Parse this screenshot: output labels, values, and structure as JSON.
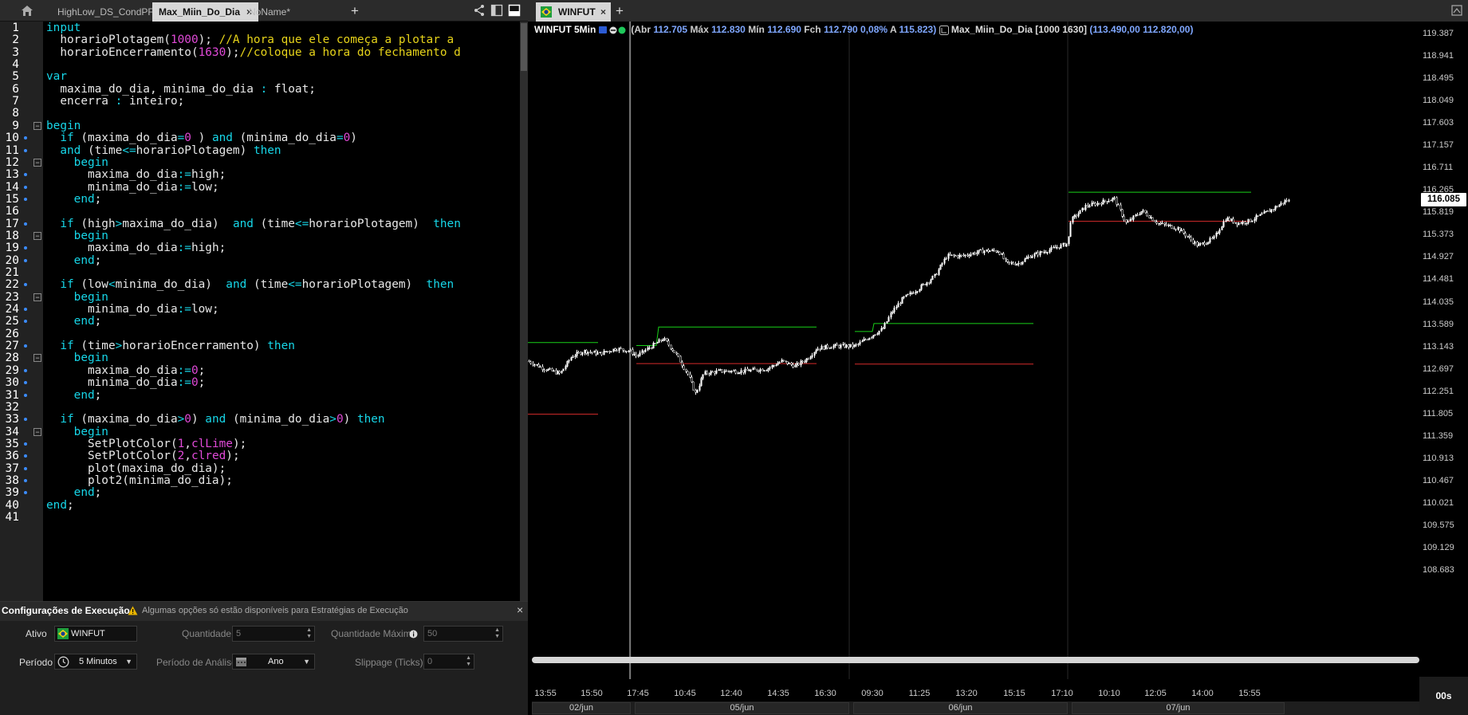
{
  "editor": {
    "tabs": [
      {
        "label": "HighLow_DS_CondPF_Agr",
        "active": false
      },
      {
        "label": "Max_Miin_Do_Dia",
        "active": true,
        "close": "×"
      },
      {
        "label": "NoName*",
        "active": false
      }
    ],
    "add_tab": "+",
    "lines": [
      {
        "n": "1",
        "segs": [
          [
            "kw",
            "input"
          ]
        ]
      },
      {
        "n": "2",
        "segs": [
          [
            "",
            "  horarioPlotagem("
          ],
          [
            "num",
            "1000"
          ],
          [
            "",
            "); "
          ],
          [
            "cm",
            "//A hora que ele começa a plotar a"
          ]
        ]
      },
      {
        "n": "3",
        "segs": [
          [
            "",
            "  horarioEncerramento("
          ],
          [
            "num",
            "1630"
          ],
          [
            "",
            ");"
          ],
          [
            "cm",
            "//coloque a hora do fechamento d"
          ]
        ]
      },
      {
        "n": "4",
        "segs": []
      },
      {
        "n": "5",
        "segs": [
          [
            "kw",
            "var"
          ]
        ]
      },
      {
        "n": "6",
        "segs": [
          [
            "",
            "  maxima_do_dia, minima_do_dia "
          ],
          [
            "op",
            ":"
          ],
          [
            "",
            " float;"
          ]
        ]
      },
      {
        "n": "7",
        "segs": [
          [
            "",
            "  encerra "
          ],
          [
            "op",
            ":"
          ],
          [
            "",
            " inteiro;"
          ]
        ]
      },
      {
        "n": "8",
        "segs": []
      },
      {
        "n": "9",
        "segs": [
          [
            "kw",
            "begin"
          ]
        ]
      },
      {
        "n": "10",
        "segs": [
          [
            "",
            "  "
          ],
          [
            "kw",
            "if"
          ],
          [
            "",
            " (maxima_do_dia"
          ],
          [
            "op",
            "="
          ],
          [
            "num",
            "0"
          ],
          [
            "",
            " ) "
          ],
          [
            "kw",
            "and"
          ],
          [
            "",
            " (minima_do_dia"
          ],
          [
            "op",
            "="
          ],
          [
            "num",
            "0"
          ],
          [
            "",
            ")"
          ]
        ]
      },
      {
        "n": "11",
        "segs": [
          [
            "",
            "  "
          ],
          [
            "kw",
            "and"
          ],
          [
            "",
            " (time"
          ],
          [
            "op",
            "<="
          ],
          [
            "",
            "horarioPlotagem) "
          ],
          [
            "kw",
            "then"
          ]
        ]
      },
      {
        "n": "12",
        "segs": [
          [
            "",
            "    "
          ],
          [
            "kw",
            "begin"
          ]
        ]
      },
      {
        "n": "13",
        "segs": [
          [
            "",
            "      maxima_do_dia"
          ],
          [
            "op",
            ":="
          ],
          [
            "",
            "high;"
          ]
        ]
      },
      {
        "n": "14",
        "segs": [
          [
            "",
            "      minima_do_dia"
          ],
          [
            "op",
            ":="
          ],
          [
            "",
            "low;"
          ]
        ]
      },
      {
        "n": "15",
        "segs": [
          [
            "",
            "    "
          ],
          [
            "kw",
            "end"
          ],
          [
            "",
            ";"
          ]
        ]
      },
      {
        "n": "16",
        "segs": []
      },
      {
        "n": "17",
        "segs": [
          [
            "",
            "  "
          ],
          [
            "kw",
            "if"
          ],
          [
            "",
            " (high"
          ],
          [
            "op",
            ">"
          ],
          [
            "",
            "maxima_do_dia)  "
          ],
          [
            "kw",
            "and"
          ],
          [
            "",
            " (time"
          ],
          [
            "op",
            "<="
          ],
          [
            "",
            "horarioPlotagem)  "
          ],
          [
            "kw",
            "then"
          ]
        ]
      },
      {
        "n": "18",
        "segs": [
          [
            "",
            "    "
          ],
          [
            "kw",
            "begin"
          ]
        ]
      },
      {
        "n": "19",
        "segs": [
          [
            "",
            "      maxima_do_dia"
          ],
          [
            "op",
            ":="
          ],
          [
            "",
            "high;"
          ]
        ]
      },
      {
        "n": "20",
        "segs": [
          [
            "",
            "    "
          ],
          [
            "kw",
            "end"
          ],
          [
            "",
            ";"
          ]
        ]
      },
      {
        "n": "21",
        "segs": []
      },
      {
        "n": "22",
        "segs": [
          [
            "",
            "  "
          ],
          [
            "kw",
            "if"
          ],
          [
            "",
            " (low"
          ],
          [
            "op",
            "<"
          ],
          [
            "",
            "minima_do_dia)  "
          ],
          [
            "kw",
            "and"
          ],
          [
            "",
            " (time"
          ],
          [
            "op",
            "<="
          ],
          [
            "",
            "horarioPlotagem)  "
          ],
          [
            "kw",
            "then"
          ]
        ]
      },
      {
        "n": "23",
        "segs": [
          [
            "",
            "    "
          ],
          [
            "kw",
            "begin"
          ]
        ]
      },
      {
        "n": "24",
        "segs": [
          [
            "",
            "      minima_do_dia"
          ],
          [
            "op",
            ":="
          ],
          [
            "",
            "low;"
          ]
        ]
      },
      {
        "n": "25",
        "segs": [
          [
            "",
            "    "
          ],
          [
            "kw",
            "end"
          ],
          [
            "",
            ";"
          ]
        ]
      },
      {
        "n": "26",
        "segs": []
      },
      {
        "n": "27",
        "segs": [
          [
            "",
            "  "
          ],
          [
            "kw",
            "if"
          ],
          [
            "",
            " (time"
          ],
          [
            "op",
            ">"
          ],
          [
            "",
            "horarioEncerramento) "
          ],
          [
            "kw",
            "then"
          ]
        ]
      },
      {
        "n": "28",
        "segs": [
          [
            "",
            "    "
          ],
          [
            "kw",
            "begin"
          ]
        ]
      },
      {
        "n": "29",
        "segs": [
          [
            "",
            "      maxima_do_dia"
          ],
          [
            "op",
            ":="
          ],
          [
            "num",
            "0"
          ],
          [
            "",
            ";"
          ]
        ]
      },
      {
        "n": "30",
        "segs": [
          [
            "",
            "      minima_do_dia"
          ],
          [
            "op",
            ":="
          ],
          [
            "num",
            "0"
          ],
          [
            "",
            ";"
          ]
        ]
      },
      {
        "n": "31",
        "segs": [
          [
            "",
            "    "
          ],
          [
            "kw",
            "end"
          ],
          [
            "",
            ";"
          ]
        ]
      },
      {
        "n": "32",
        "segs": []
      },
      {
        "n": "33",
        "segs": [
          [
            "",
            "  "
          ],
          [
            "kw",
            "if"
          ],
          [
            "",
            " (maxima_do_dia"
          ],
          [
            "op",
            ">"
          ],
          [
            "num",
            "0"
          ],
          [
            "",
            ") "
          ],
          [
            "kw",
            "and"
          ],
          [
            "",
            " (minima_do_dia"
          ],
          [
            "op",
            ">"
          ],
          [
            "num",
            "0"
          ],
          [
            "",
            ") "
          ],
          [
            "kw",
            "then"
          ]
        ]
      },
      {
        "n": "34",
        "segs": [
          [
            "",
            "    "
          ],
          [
            "kw",
            "begin"
          ]
        ]
      },
      {
        "n": "35",
        "segs": [
          [
            "",
            "      SetPlotColor("
          ],
          [
            "num",
            "1"
          ],
          [
            "",
            ","
          ],
          [
            "fn",
            "clLime"
          ],
          [
            "",
            ");"
          ]
        ]
      },
      {
        "n": "36",
        "segs": [
          [
            "",
            "      SetPlotColor("
          ],
          [
            "num",
            "2"
          ],
          [
            "",
            ","
          ],
          [
            "fn",
            "clred"
          ],
          [
            "",
            ");"
          ]
        ]
      },
      {
        "n": "37",
        "segs": [
          [
            "",
            "      plot(maxima_do_dia);"
          ]
        ]
      },
      {
        "n": "38",
        "segs": [
          [
            "",
            "      plot2(minima_do_dia);"
          ]
        ]
      },
      {
        "n": "39",
        "segs": [
          [
            "",
            "    "
          ],
          [
            "kw",
            "end"
          ],
          [
            "",
            ";"
          ]
        ]
      },
      {
        "n": "40",
        "segs": [
          [
            "kw",
            "end"
          ],
          [
            "",
            ";"
          ]
        ]
      },
      {
        "n": "41",
        "segs": []
      }
    ]
  },
  "config": {
    "title": "Configurações de Execução",
    "warning": "Algumas opções só estão disponíveis para Estratégias de Execução",
    "close": "×",
    "ativo_label": "Ativo",
    "ativo_value": "WINFUT",
    "quantidade_label": "Quantidade",
    "quantidade_value": "5",
    "qmax_label": "Quantidade Máxima",
    "qmax_value": "50",
    "periodo_label": "Período",
    "periodo_value": "5 Minutos",
    "analise_label": "Período de Análise",
    "analise_value": "Ano",
    "slippage_label": "Slippage (Ticks)",
    "slippage_value": "0"
  },
  "chart": {
    "tab_label": "WINFUT",
    "tab_close": "×",
    "add_tab": "+",
    "legend": {
      "symbol": "WINFUT 5Min",
      "abr_label": "(Abr",
      "abr": "112.705",
      "max_label": "Máx",
      "max": "112.830",
      "min_label": "Mín",
      "min": "112.690",
      "fch_label": "Fch",
      "fch": "112.790",
      "pct": "0,08%",
      "a_label": "A",
      "a": "115.823)",
      "indicator": "Max_Miin_Do_Dia [1000 1630]",
      "indicator_vals": "(113.490,00 112.820,00)"
    },
    "current_price": "116.085",
    "timer": "00s",
    "colors": {
      "high_line": "#19d119",
      "low_line": "#d62b2b",
      "candles": "#ffffff",
      "legend_value": "#7fa7ff"
    },
    "price_ticks": [
      "119.387",
      "118.941",
      "118.495",
      "118.049",
      "117.603",
      "117.157",
      "116.711",
      "116.265",
      "115.819",
      "115.373",
      "114.927",
      "114.481",
      "114.035",
      "113.589",
      "113.143",
      "112.697",
      "112.251",
      "111.805",
      "111.359",
      "110.913",
      "110.467",
      "110.021",
      "109.575",
      "109.129",
      "108.683"
    ],
    "time_ticks": [
      "13:55",
      "15:50",
      "17:45",
      "10:45",
      "12:40",
      "14:35",
      "16:30",
      "09:30",
      "11:25",
      "13:20",
      "15:15",
      "17:10",
      "10:10",
      "12:05",
      "14:00",
      "15:55"
    ],
    "dates": [
      "02/jun",
      "05/jun",
      "06/jun",
      "07/jun"
    ]
  },
  "chart_data": {
    "type": "candlestick",
    "symbol": "WINFUT",
    "timeframe": "5Min",
    "sessions": [
      {
        "date": "02/jun",
        "high_line": 113.22,
        "low_line": 111.79
      },
      {
        "date": "05/jun",
        "high_line": 113.53,
        "low_line": 112.8
      },
      {
        "date": "06/jun",
        "high_line": 113.6,
        "low_line": 112.79
      },
      {
        "date": "07/jun",
        "high_line": 116.22,
        "low_line": 115.64
      }
    ],
    "last_price": 116.085,
    "ylim": [
      108.683,
      119.387
    ]
  }
}
